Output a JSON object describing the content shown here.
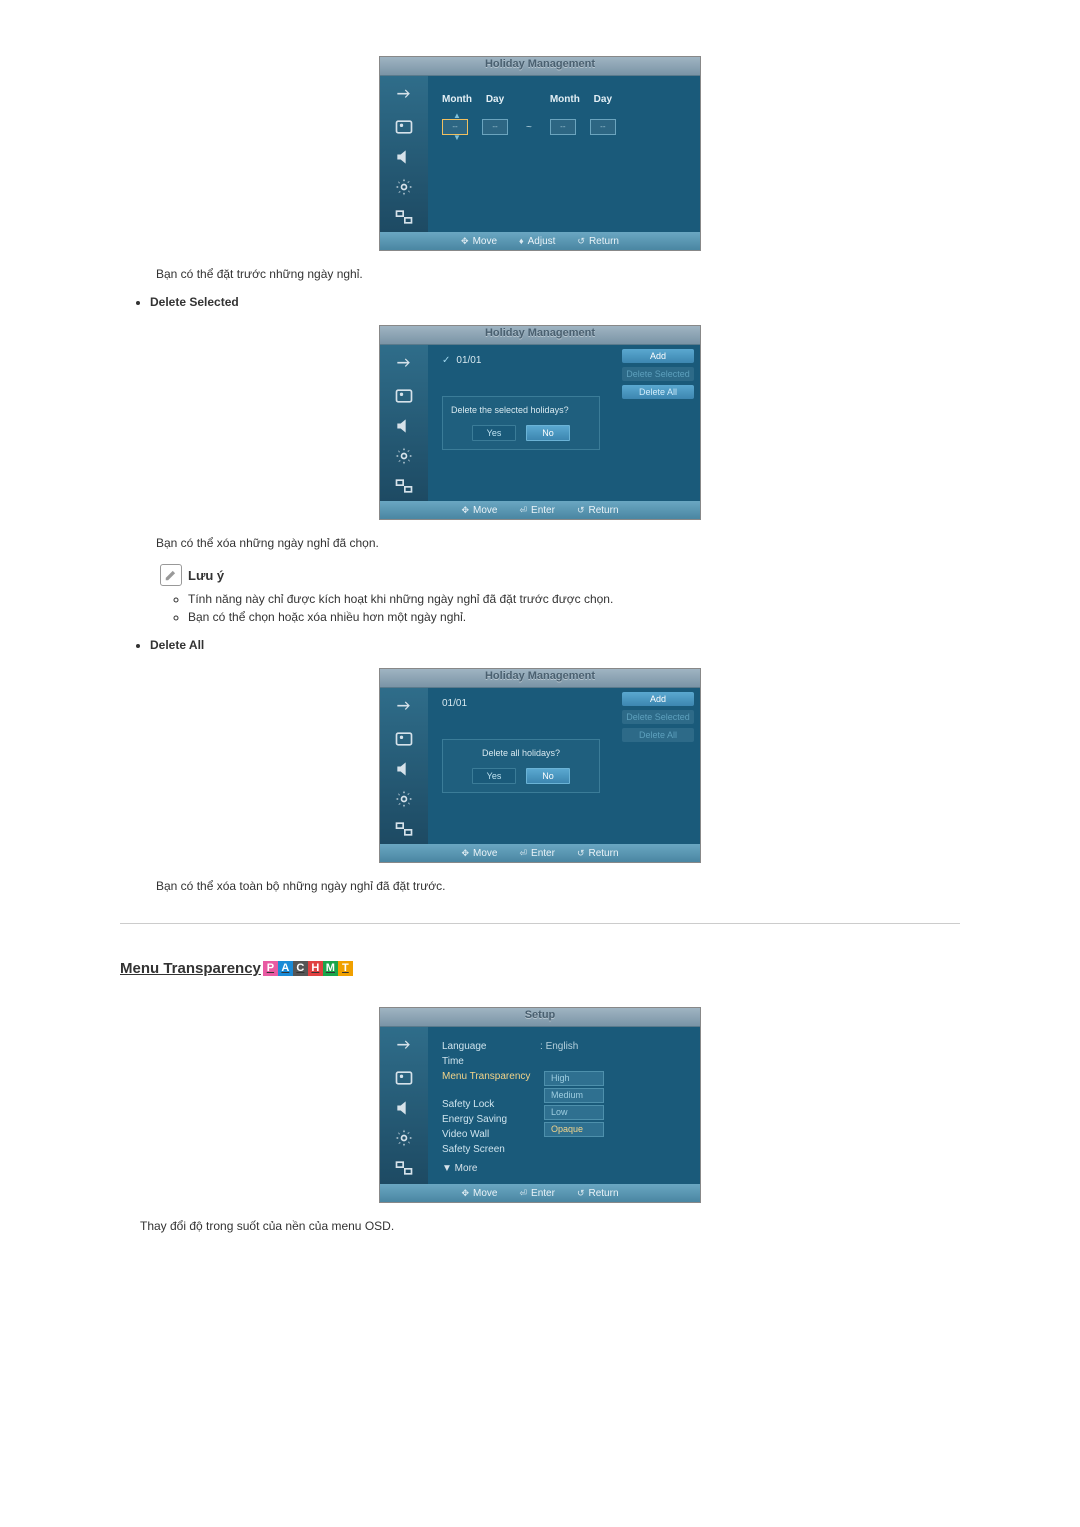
{
  "panel1": {
    "title": "Holiday Management",
    "labels": {
      "month": "Month",
      "day": "Day"
    },
    "values": {
      "m1": "--",
      "d1": "--",
      "m2": "--",
      "d2": "--",
      "dash": "~"
    },
    "hints": {
      "move": "Move",
      "adjust": "Adjust",
      "return": "Return"
    }
  },
  "desc1": "Bạn có thể đặt trước những ngày nghỉ.",
  "bullet_delete_selected": "Delete Selected",
  "panel2": {
    "title": "Holiday Management",
    "entry": "01/01",
    "buttons": {
      "add": "Add",
      "delsel": "Delete Selected",
      "delall": "Delete All"
    },
    "dialog": {
      "msg": "Delete the selected holidays?",
      "yes": "Yes",
      "no": "No"
    },
    "hints": {
      "move": "Move",
      "enter": "Enter",
      "return": "Return"
    }
  },
  "desc2": "Bạn có thể xóa những ngày nghỉ đã chọn.",
  "note": {
    "title": "Lưu ý",
    "li1": "Tính năng này chỉ được kích hoạt khi những ngày nghỉ đã đặt trước được chọn.",
    "li2": "Bạn có thể chọn hoặc xóa nhiều hơn một ngày nghỉ."
  },
  "bullet_delete_all": "Delete All",
  "panel3": {
    "title": "Holiday Management",
    "entry": "01/01",
    "buttons": {
      "add": "Add",
      "delsel": "Delete Selected",
      "delall": "Delete All"
    },
    "dialog": {
      "msg": "Delete all holidays?",
      "yes": "Yes",
      "no": "No"
    },
    "hints": {
      "move": "Move",
      "enter": "Enter",
      "return": "Return"
    }
  },
  "desc3": "Bạn có thể xóa toàn bộ những ngày nghỉ đã đặt trước.",
  "section_title": "Menu Transparency",
  "badges": {
    "p": "P",
    "a": "A",
    "c": "C",
    "h": "H",
    "m": "M",
    "t": "T"
  },
  "panel4": {
    "title": "Setup",
    "items": {
      "language_label": "Language",
      "language_value": "English",
      "time_label": "Time",
      "transparency_label": "Menu Transparency",
      "safety_lock_label": "Safety Lock",
      "energy_saving_label": "Energy Saving",
      "video_wall_label": "Video Wall",
      "safety_screen_label": "Safety Screen",
      "more_label": "▼ More"
    },
    "options": {
      "high": "High",
      "medium": "Medium",
      "low": "Low",
      "opaque": "Opaque"
    },
    "hints": {
      "move": "Move",
      "enter": "Enter",
      "return": "Return"
    }
  },
  "desc4": "Thay đổi độ trong suốt của nền của menu OSD."
}
